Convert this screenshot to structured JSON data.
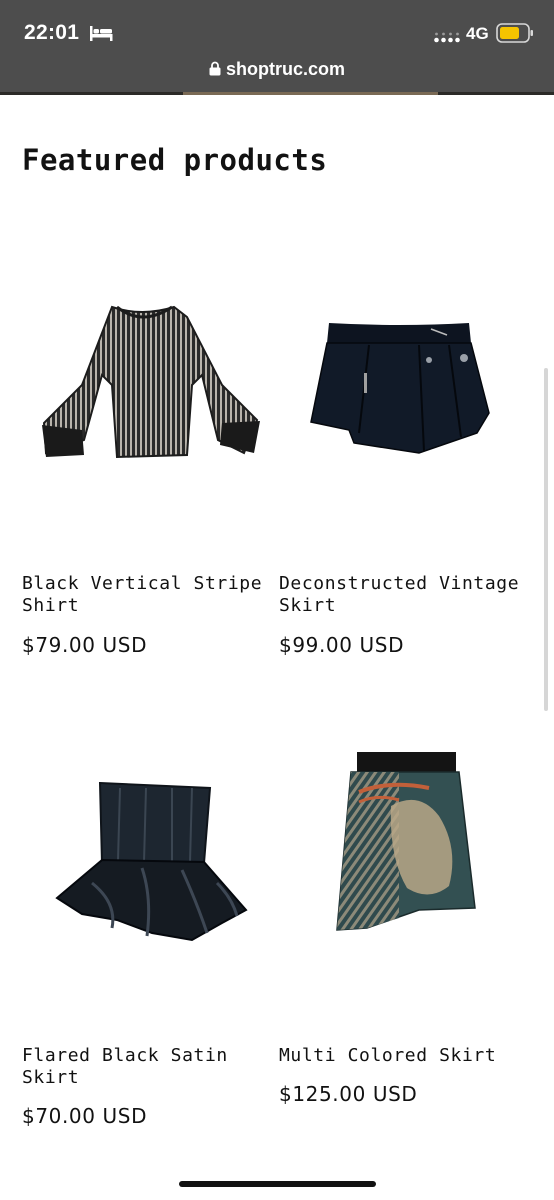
{
  "status_bar": {
    "time": "22:01",
    "network": "4G",
    "accent_battery": "#f5c400",
    "icons": [
      "bed-icon",
      "signal-icon",
      "battery-icon"
    ]
  },
  "browser": {
    "url": "shoptruc.com",
    "icon": "lock-icon"
  },
  "section": {
    "title": "Featured products"
  },
  "products": [
    {
      "name": "Black Vertical Stripe Shirt",
      "price": "$79.00 USD"
    },
    {
      "name": "Deconstructed Vintage Skirt",
      "price": "$99.00 USD"
    },
    {
      "name": "Flared Black Satin Skirt",
      "price": "$70.00 USD"
    },
    {
      "name": "Multi Colored Skirt",
      "price": "$125.00 USD"
    }
  ]
}
